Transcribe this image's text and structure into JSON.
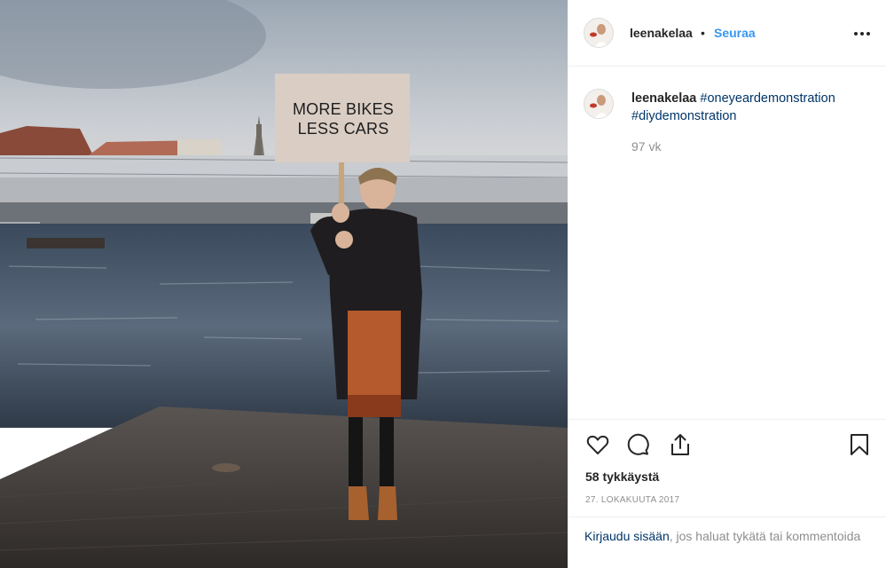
{
  "photo": {
    "sign_line1": "MORE BIKES",
    "sign_line2": "LESS CARS"
  },
  "header": {
    "username": "leenakelaa",
    "separator": "•",
    "follow_label": "Seuraa",
    "more_icon": "more-horizontal-icon"
  },
  "caption": {
    "username": "leenakelaa",
    "tag1": "#oneyeardemonstration",
    "tag2": "#diydemonstration",
    "time": "97 vk"
  },
  "actions": {
    "like_icon": "heart-icon",
    "comment_icon": "comment-icon",
    "share_icon": "share-icon",
    "save_icon": "bookmark-icon",
    "likes_text": "58 tykkäystä",
    "date": "27. LOKAKUUTA 2017"
  },
  "login": {
    "link_text": "Kirjaudu sisään",
    "rest_text": ", jos haluat tykätä tai kommentoida"
  },
  "colors": {
    "link_blue": "#3897f0",
    "hashtag": "#003569",
    "muted": "#8e8e8e"
  }
}
